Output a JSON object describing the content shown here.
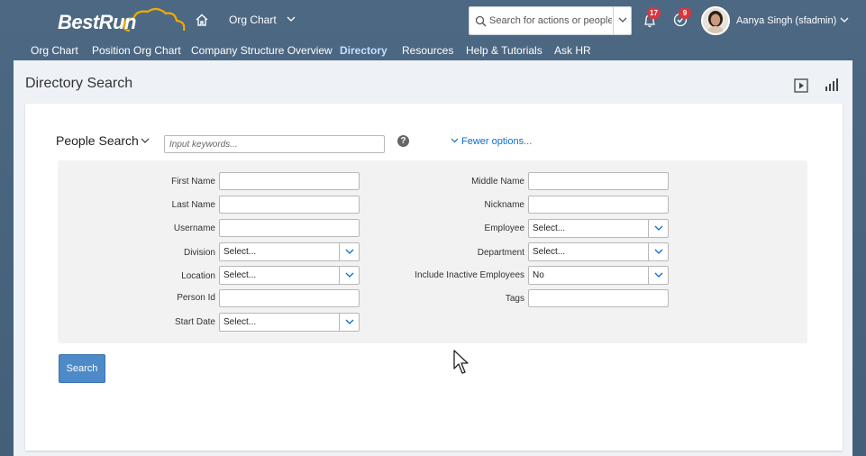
{
  "header": {
    "logo_text": "BestRun",
    "module_title": "Org Chart",
    "search_placeholder": "Search for actions or people",
    "notifications_count": "17",
    "todo_count": "9",
    "user_name": "Aanya Singh (sfadmin)"
  },
  "nav": {
    "items": [
      "Org Chart",
      "Position Org Chart",
      "Company Structure Overview",
      "Directory",
      "Resources",
      "Help & Tutorials",
      "Ask HR"
    ],
    "active": "Directory"
  },
  "page": {
    "title": "Directory Search"
  },
  "people_search": {
    "title": "People Search",
    "keyword_placeholder": "Input keywords...",
    "help_symbol": "?",
    "fewer_options": "Fewer options...",
    "left_fields": [
      {
        "label": "First Name",
        "value": ""
      },
      {
        "label": "Last Name",
        "value": ""
      },
      {
        "label": "Username",
        "value": ""
      },
      {
        "label": "Division",
        "value": "Select..."
      },
      {
        "label": "Location",
        "value": "Select..."
      },
      {
        "label": "Person Id",
        "value": ""
      },
      {
        "label": "Start Date",
        "value": "Select..."
      }
    ],
    "right_fields": [
      {
        "label": "Middle Name",
        "value": ""
      },
      {
        "label": "Nickname",
        "value": ""
      },
      {
        "label": "Employee",
        "value": "Select..."
      },
      {
        "label": "Department",
        "value": "Select..."
      },
      {
        "label": "Include Inactive Employees",
        "value": "No"
      },
      {
        "label": "Tags",
        "value": ""
      }
    ],
    "search_button": "Search"
  },
  "colors": {
    "header_bg": "#4d6883",
    "active_nav": "#bfe0ff",
    "link": "#0a6ed1",
    "primary_button": "#4d8ac7",
    "badge": "#d9363e"
  }
}
